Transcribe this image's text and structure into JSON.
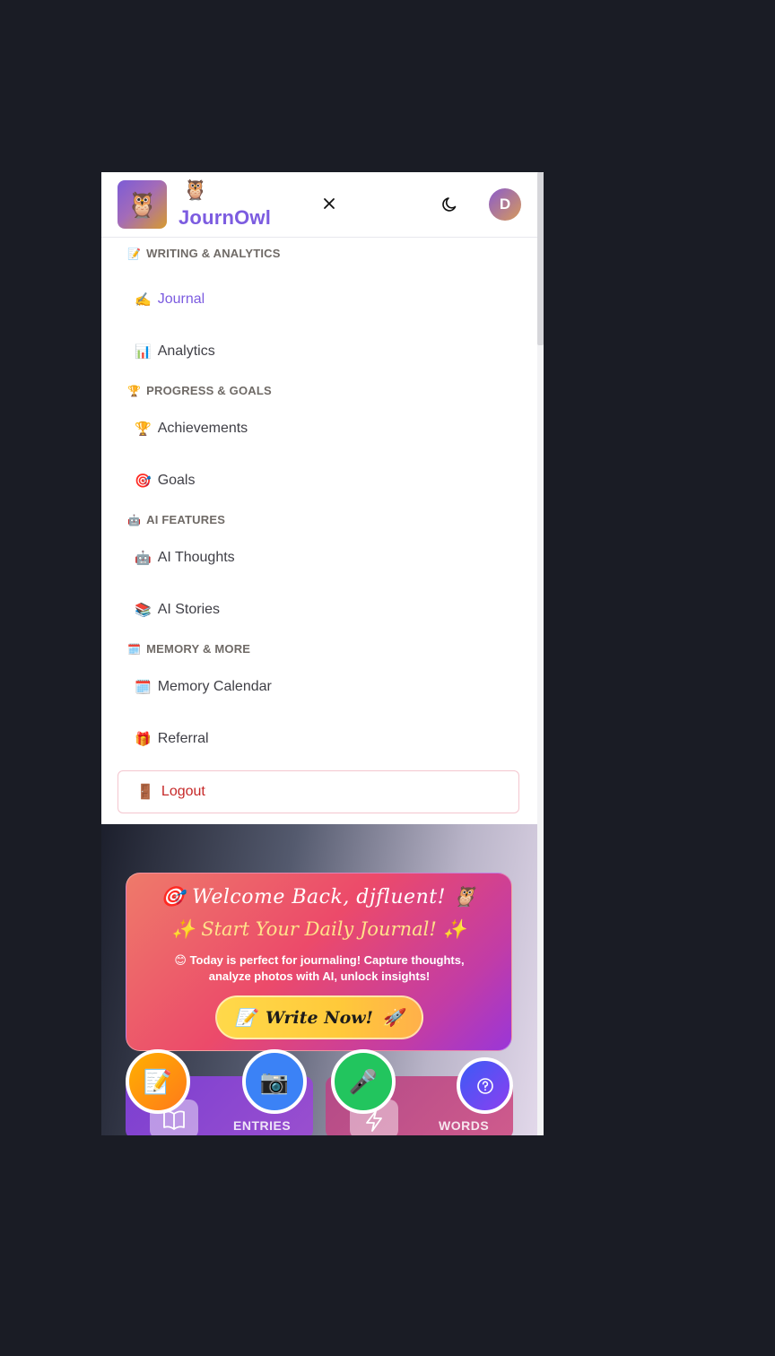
{
  "header": {
    "brand_owl": "🦉",
    "logo_emoji": "🦉",
    "brand_name": "JournOwl",
    "close_icon": "close-icon",
    "theme_icon": "moon-icon",
    "avatar_initial": "D"
  },
  "menu": {
    "sections": [
      {
        "emoji": "📝",
        "title": "WRITING & ANALYTICS"
      },
      {
        "emoji": "🏆",
        "title": "PROGRESS & GOALS"
      },
      {
        "emoji": "🤖",
        "title": "AI FEATURES"
      },
      {
        "emoji": "🗓️",
        "title": "MEMORY & MORE"
      }
    ],
    "items": [
      {
        "emoji": "✍️",
        "label": "Journal"
      },
      {
        "emoji": "📊",
        "label": "Analytics"
      },
      {
        "emoji": "🏆",
        "label": "Achievements"
      },
      {
        "emoji": "🎯",
        "label": "Goals"
      },
      {
        "emoji": "🤖",
        "label": "AI Thoughts"
      },
      {
        "emoji": "📚",
        "label": "AI Stories"
      },
      {
        "emoji": "🗓️",
        "label": "Memory Calendar"
      },
      {
        "emoji": "🎁",
        "label": "Referral"
      }
    ],
    "logout": {
      "emoji": "🚪",
      "label": "Logout"
    }
  },
  "hero": {
    "line1_prefix": "🎯",
    "line1": "Welcome Back, djfluent!",
    "line1_suffix": "🦉",
    "line2_prefix": "✨",
    "line2": "Start Your Daily Journal!",
    "line2_suffix": "✨",
    "text": "😊 Today is perfect for journaling! Capture thoughts, analyze photos with AI, unlock insights!",
    "button_prefix": "📝",
    "button_label": "Write Now!",
    "button_suffix": "🚀"
  },
  "stats": {
    "entries_label": "ENTRIES",
    "words_label": "WORDS"
  },
  "fabs": {
    "write": "📝",
    "camera": "📷",
    "mic": "🎤"
  }
}
